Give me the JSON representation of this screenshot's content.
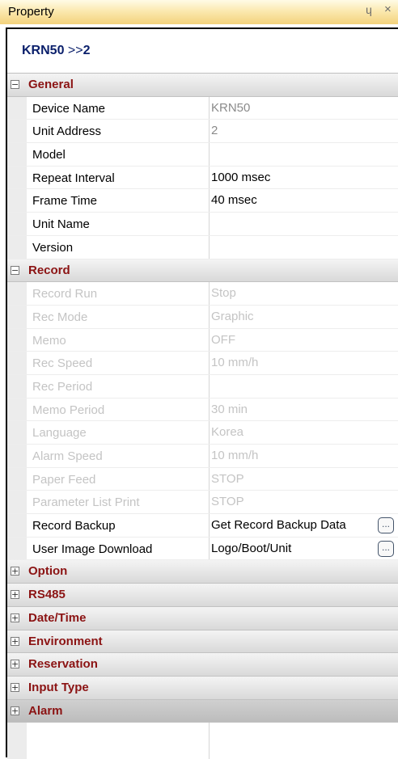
{
  "window": {
    "title": "Property",
    "pin_glyph": "ɥ",
    "close_glyph": "×"
  },
  "header": {
    "device": "KRN50",
    "separator": ">>",
    "unit": "2"
  },
  "categories": {
    "general": {
      "label": "General",
      "toggle": "−"
    },
    "record": {
      "label": "Record",
      "toggle": "−"
    },
    "option": {
      "label": "Option",
      "toggle": "+"
    },
    "rs485": {
      "label": "RS485",
      "toggle": "+"
    },
    "datetime": {
      "label": "Date/Time",
      "toggle": "+"
    },
    "environment": {
      "label": "Environment",
      "toggle": "+"
    },
    "reservation": {
      "label": "Reservation",
      "toggle": "+"
    },
    "input_type": {
      "label": "Input Type",
      "toggle": "+"
    },
    "alarm": {
      "label": "Alarm",
      "toggle": "+"
    }
  },
  "general": [
    {
      "name": "Device Name",
      "value": "KRN50"
    },
    {
      "name": "Unit Address",
      "value": "2"
    },
    {
      "name": "Model",
      "value": ""
    },
    {
      "name": "Repeat Interval",
      "value": "1000 msec"
    },
    {
      "name": "Frame Time",
      "value": "40 msec"
    },
    {
      "name": "Unit Name",
      "value": ""
    },
    {
      "name": "Version",
      "value": ""
    }
  ],
  "record": [
    {
      "name": "Record Run",
      "value": "Stop"
    },
    {
      "name": "Rec Mode",
      "value": "Graphic"
    },
    {
      "name": "Memo",
      "value": "OFF"
    },
    {
      "name": "Rec Speed",
      "value": "10 mm/h"
    },
    {
      "name": "Rec Period",
      "value": ""
    },
    {
      "name": "Memo Period",
      "value": "30 min"
    },
    {
      "name": "Language",
      "value": "Korea"
    },
    {
      "name": "Alarm Speed",
      "value": "10 mm/h"
    },
    {
      "name": "Paper Feed",
      "value": "STOP"
    },
    {
      "name": "Parameter List Print",
      "value": "STOP"
    },
    {
      "name": "Record Backup",
      "value": "Get Record Backup Data",
      "button": "..."
    },
    {
      "name": "User Image Download",
      "value": "Logo/Boot/Unit",
      "button": "..."
    }
  ]
}
